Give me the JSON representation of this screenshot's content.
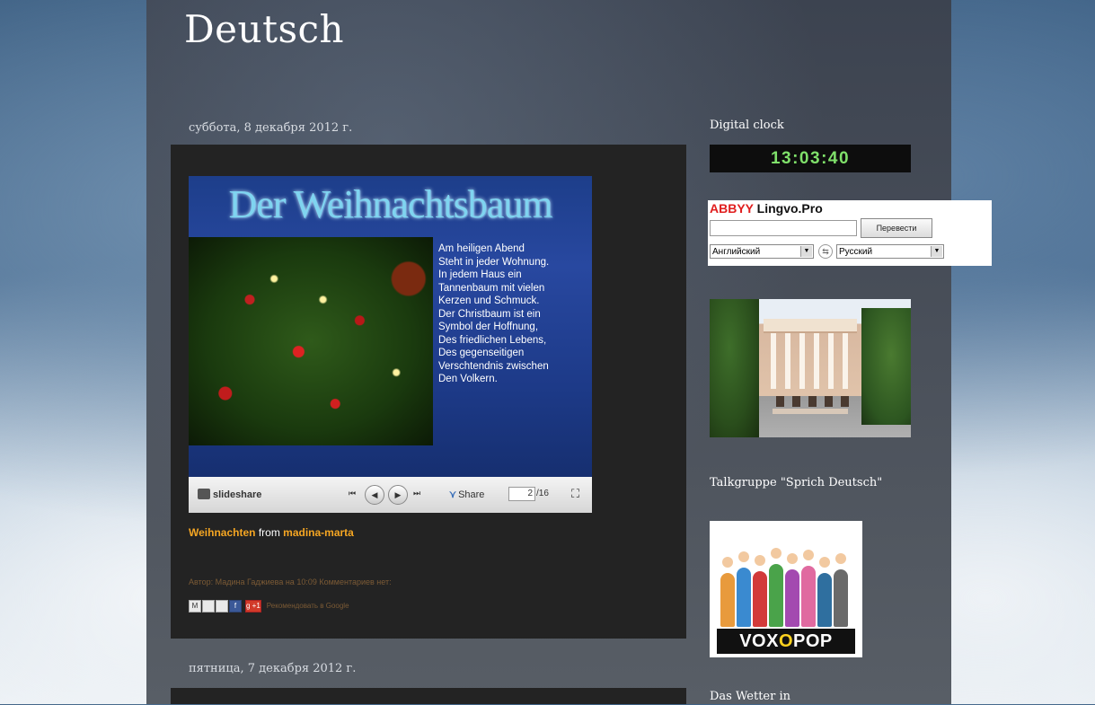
{
  "blog": {
    "title": "Deutsch"
  },
  "posts": [
    {
      "date": "суббота, 8 декабря 2012 г.",
      "slideshow": {
        "slide_title": "Der Weihnachtsbaum",
        "slide_text_lines": [
          "Am heiligen Abend",
          "Steht in jeder Wohnung.",
          "In jedem Haus ein",
          "Tannenbaum mit vielen",
          "Kerzen und Schmuck.",
          "Der Christbaum ist ein",
          "Symbol der Hoffnung,",
          "Des friedlichen Lebens,",
          "Des gegenseitigen",
          "Verschtendnis zwischen",
          "Den Volkern."
        ],
        "brand": "slideshare",
        "share_label": "Share",
        "current_page": "2",
        "total_pages": "/16"
      },
      "link_title": "Weihnachten",
      "link_from": "from",
      "link_author": "madina-marta",
      "footer": "Автор: Мадина Гаджиева на 10:09    Комментариев нет:",
      "share_buttons": [
        "M",
        "",
        "",
        "f",
        "g +1"
      ],
      "recommend": "Рекомендовать в Google"
    },
    {
      "date": "пятница, 7 декабря 2012 г."
    }
  ],
  "sidebar": {
    "clock_title": "Digital clock",
    "clock_value": "13:03:40",
    "lingvo": {
      "brand_a": "ABBYY",
      "brand_b": "Lingvo.Pro",
      "input_value": "",
      "translate_button": "Перевести",
      "source_lang": "Английский",
      "target_lang": "Русский"
    },
    "talkgroup_title": "Talkgruppe \"Sprich Deutsch\"",
    "voxpop_logo_a": "VOX",
    "voxpop_logo_o": "O",
    "voxpop_logo_b": "POP",
    "weather_title": "Das Wetter in"
  }
}
